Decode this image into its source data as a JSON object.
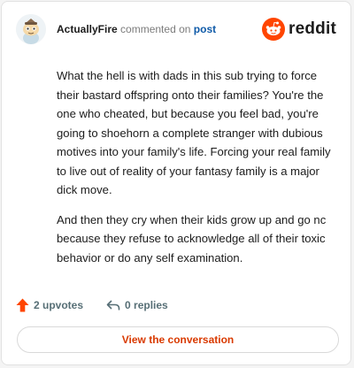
{
  "header": {
    "username": "ActuallyFire",
    "action_text": "commented on",
    "post_link": "post",
    "logo_text": "reddit",
    "avatar_icon": "snoo-avatar-icon",
    "brand_color": "#ff4500"
  },
  "comment": {
    "paragraphs": [
      "What the hell is with dads in this sub trying to force their bastard offspring onto their families? You're the one who cheated, but because you feel bad, you're going to shoehorn a complete stranger with dubious motives into your family's life. Forcing your real family to live out of reality of your fantasy family is a major dick move.",
      "And then they cry when their kids grow up and go nc because they refuse to acknowledge all of their toxic behavior or do any self examination."
    ]
  },
  "actions": {
    "upvotes": "2 upvotes",
    "replies": "0 replies",
    "upvote_icon": "upvote-arrow-icon",
    "reply_icon": "reply-arrow-icon"
  },
  "cta": {
    "label": "View the conversation"
  }
}
